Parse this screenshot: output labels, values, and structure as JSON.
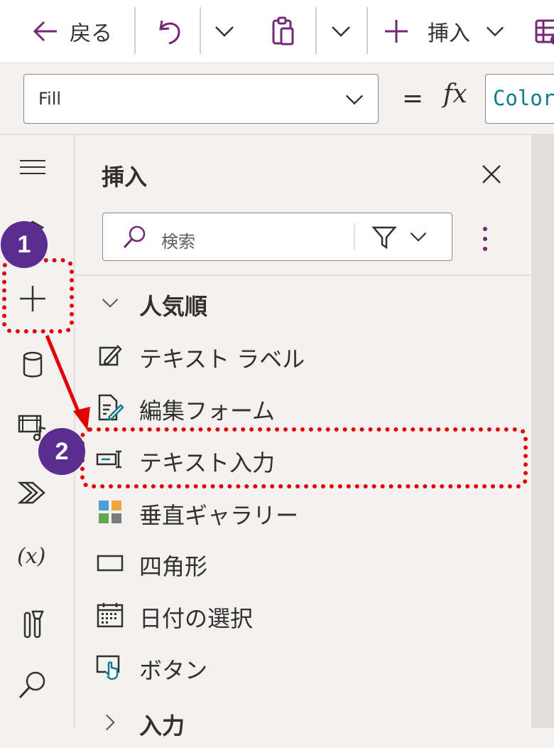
{
  "toolbar": {
    "back_label": "戻る",
    "insert_label": "挿入"
  },
  "formula_bar": {
    "property": "Fill",
    "equals": "=",
    "fx": "fx",
    "formula": "ColorV"
  },
  "insert_panel": {
    "title": "挿入",
    "search_placeholder": "検索",
    "groups": [
      {
        "label": "人気順",
        "expanded": true,
        "items": [
          {
            "label": "テキスト ラベル",
            "icon": "text-label-icon"
          },
          {
            "label": "編集フォーム",
            "icon": "edit-form-icon"
          },
          {
            "label": "テキスト入力",
            "icon": "text-input-icon"
          },
          {
            "label": "垂直ギャラリー",
            "icon": "gallery-icon"
          },
          {
            "label": "四角形",
            "icon": "rectangle-icon"
          },
          {
            "label": "日付の選択",
            "icon": "date-picker-icon"
          },
          {
            "label": "ボタン",
            "icon": "button-icon"
          }
        ]
      },
      {
        "label": "入力",
        "expanded": false
      }
    ]
  },
  "rail": {
    "items": [
      "hamburger-menu-icon",
      "tree-view-icon",
      "insert-icon",
      "data-icon",
      "media-icon",
      "power-automate-icon",
      "variables-icon",
      "advanced-tools-icon",
      "search-icon"
    ]
  },
  "annotations": {
    "step1": "1",
    "step2": "2"
  },
  "colors": {
    "accent_purple": "#742774",
    "annotation_red": "#e30000",
    "badge_purple": "#5c2d91",
    "formula_teal": "#0e7d8a"
  }
}
